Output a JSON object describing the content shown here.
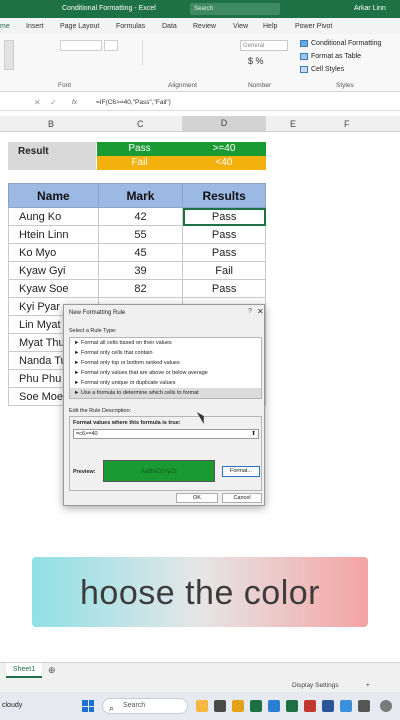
{
  "window": {
    "title": "Conditional Formatting - Excel",
    "search_placeholder": "Search",
    "user": "Arkar Linn"
  },
  "ribbon_tabs": [
    "me",
    "Insert",
    "Page Layout",
    "Formulas",
    "Data",
    "Review",
    "View",
    "Help",
    "Power Pivot"
  ],
  "ribbon": {
    "groups": {
      "font": "Font",
      "alignment": "Alignment",
      "number": "Number",
      "styles": "Styles"
    },
    "number_format": "General",
    "styles_buttons": [
      "Conditional Formatting",
      "Format as Table",
      "Cell Styles"
    ]
  },
  "formula_bar": {
    "fx": "fx",
    "formula": "=IF(C6>=40,\"Pass\",\"Fail\")"
  },
  "columns": [
    "B",
    "C",
    "D",
    "E",
    "F"
  ],
  "result_block": {
    "label": "Result",
    "pass": "Pass",
    "fail": "Fail",
    "cond_pass": ">=40",
    "cond_fail": "<40",
    "colors": {
      "pass": "#1a9a32",
      "fail": "#f2b10c"
    }
  },
  "table": {
    "headers": [
      "Name",
      "Mark",
      "Results"
    ],
    "rows": [
      {
        "name": "Aung Ko",
        "mark": "42",
        "result": "Pass"
      },
      {
        "name": "Htein Linn",
        "mark": "55",
        "result": "Pass"
      },
      {
        "name": "Ko Myo",
        "mark": "45",
        "result": "Pass"
      },
      {
        "name": "Kyaw Gyi",
        "mark": "39",
        "result": "Fail"
      },
      {
        "name": "Kyaw Soe",
        "mark": "82",
        "result": "Pass"
      },
      {
        "name": "Kyi Pyar",
        "mark": "",
        "result": ""
      },
      {
        "name": "Lin Myat",
        "mark": "",
        "result": ""
      },
      {
        "name": "Myat Thu",
        "mark": "",
        "result": ""
      },
      {
        "name": "Nanda Tu",
        "mark": "",
        "result": ""
      },
      {
        "name": "Phu Phu",
        "mark": "",
        "result": ""
      },
      {
        "name": "Soe Moe",
        "mark": "",
        "result": ""
      }
    ]
  },
  "dialog": {
    "title": "New Formatting Rule",
    "help": "?",
    "close": "✕",
    "select_rule_label": "Select a Rule Type:",
    "rule_types": [
      "► Format all cells based on their values",
      "► Format only cells that contain",
      "► Format only top or bottom ranked values",
      "► Format only values that are above or below average",
      "► Format only unique or duplicate values",
      "► Use a formula to determine which cells to format"
    ],
    "edit_label": "Edit the Rule Description:",
    "formula_label": "Format values where this formula is true:",
    "formula_value": "=c6>=40",
    "preview_label": "Preview:",
    "preview_text": "AaBbCcYyZz",
    "format_button": "Format...",
    "ok_button": "OK",
    "cancel_button": "Cancel",
    "preview_color": "#1a9a32"
  },
  "caption": "hoose the color",
  "sheet_tabs": [
    "Sheet1"
  ],
  "status": {
    "display_settings": "Display Settings",
    "zoom": "+"
  },
  "taskbar": {
    "weather": "cloudy",
    "search": "Search"
  }
}
